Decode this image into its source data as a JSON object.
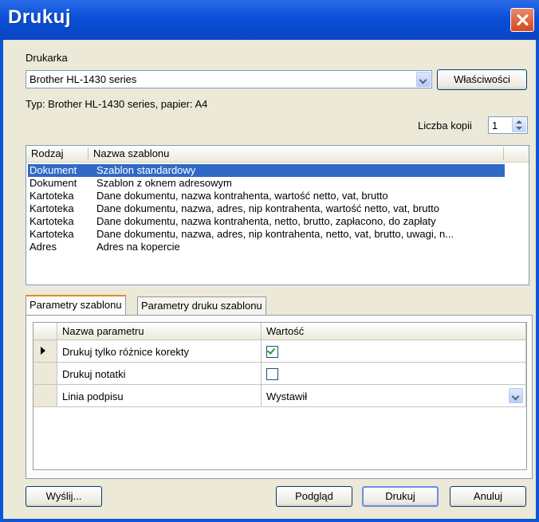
{
  "window": {
    "title": "Drukuj"
  },
  "printer": {
    "label": "Drukarka",
    "selected": "Brother HL-1430 series",
    "properties_button": "Właściwości",
    "info": "Typ: Brother HL-1430 series, papier: A4"
  },
  "copies": {
    "label": "Liczba kopii",
    "value": "1"
  },
  "templates": {
    "columns": [
      "Rodzaj",
      "Nazwa szablonu"
    ],
    "rows": [
      {
        "type": "Dokument",
        "name": "Szablon standardowy",
        "selected": true
      },
      {
        "type": "Dokument",
        "name": "Szablon z oknem adresowym"
      },
      {
        "type": "Kartoteka",
        "name": "Dane dokumentu, nazwa kontrahenta, wartość netto, vat, brutto"
      },
      {
        "type": "Kartoteka",
        "name": "Dane dokumentu, nazwa, adres, nip kontrahenta, wartość netto, vat, brutto"
      },
      {
        "type": "Kartoteka",
        "name": "Dane dokumentu, nazwa kontrahenta, netto, brutto, zapłacono, do zapłaty"
      },
      {
        "type": "Kartoteka",
        "name": "Dane dokumentu, nazwa, adres, nip kontrahenta, netto, vat, brutto, uwagi, n..."
      },
      {
        "type": "Adres",
        "name": "Adres na kopercie"
      }
    ]
  },
  "tabs": [
    "Parametry szablonu",
    "Parametry druku szablonu"
  ],
  "params": {
    "columns": [
      "Nazwa parametru",
      "Wartość"
    ],
    "rows": [
      {
        "name": "Drukuj tylko różnice korekty",
        "checked": true
      },
      {
        "name": "Drukuj notatki",
        "checked": false
      },
      {
        "name": "Linia podpisu",
        "value": "Wystawił"
      }
    ]
  },
  "buttons": {
    "send": "Wyślij...",
    "preview": "Podgląd",
    "print": "Drukuj",
    "cancel": "Anuluj"
  },
  "colors": {
    "titlebar": "#0a4fd6",
    "selection": "#316ac5",
    "dialog_bg": "#ece9d8"
  }
}
